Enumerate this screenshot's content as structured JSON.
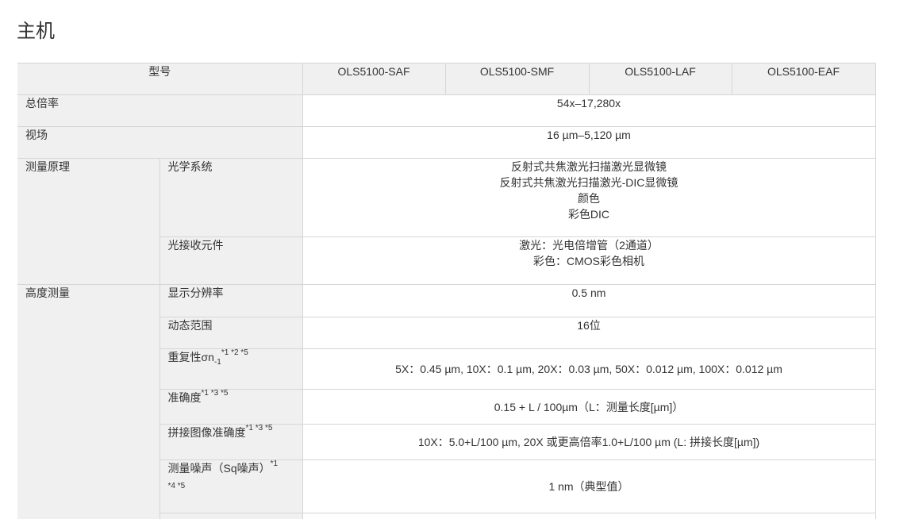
{
  "title": "主机",
  "header": {
    "model_label": "型号",
    "models": [
      "OLS5100-SAF",
      "OLS5100-SMF",
      "OLS5100-LAF",
      "OLS5100-EAF"
    ]
  },
  "rows": {
    "total_mag": {
      "label": "总倍率",
      "value": "54x–17,280x"
    },
    "fov": {
      "label": "视场",
      "value": "16 µm–5,120 µm"
    },
    "principle": {
      "label": "测量原理",
      "optics_label": "光学系统",
      "optics_lines": [
        "反射式共焦激光扫描激光显微镜",
        "反射式共焦激光扫描激光-DIC显微镜",
        "颜色",
        "彩色DIC"
      ],
      "receiver_label": "光接收元件",
      "receiver_lines": [
        "激光：光电倍增管（2通道）",
        "彩色：CMOS彩色相机"
      ]
    },
    "height": {
      "label": "高度测量",
      "resolution_label": "显示分辨率",
      "resolution_value": "0.5 nm",
      "range_label": "动态范围",
      "range_value": "16位",
      "repeat_label": "重复性σn",
      "repeat_sub": "-1",
      "repeat_sup": "*1 *2 *5",
      "repeat_value": "5X：0.45 µm, 10X：0.1 µm, 20X：0.03 µm, 50X：0.012 µm, 100X：0.012 µm",
      "accuracy_label": "准确度",
      "accuracy_sup": "*1 *3 *5",
      "accuracy_value": "0.15 + L / 100µm（L：测量长度[µm]）",
      "stitch_label": "拼接图像准确度",
      "stitch_sup": "*1 *3 *5",
      "stitch_value": "10X：5.0+L/100 µm, 20X 或更高倍率1.0+L/100 µm (L: 拼接长度[µm])",
      "noise_label": "测量噪声（Sq噪声）",
      "noise_sup": "*1",
      "noise_sup2": "*4 *5",
      "noise_value": "1 nm（典型值）"
    }
  }
}
